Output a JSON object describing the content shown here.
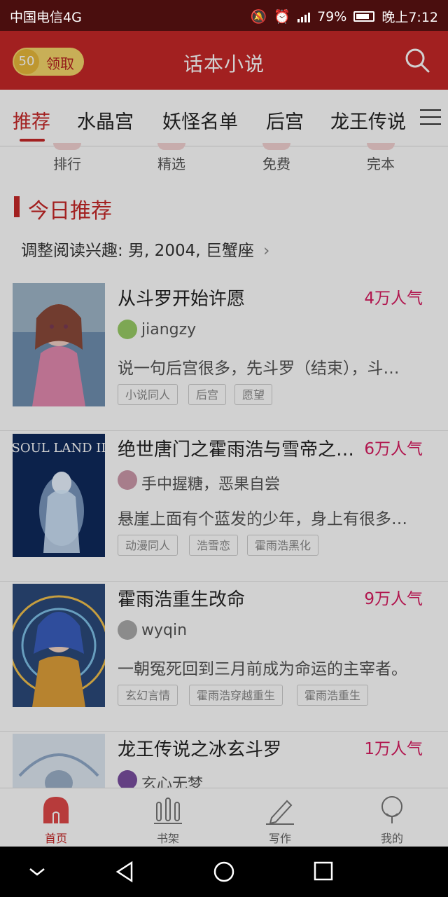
{
  "status": {
    "carrier": "中国电信4G",
    "battery": "79%",
    "time": "晚上7:12",
    "network": "4G"
  },
  "header": {
    "coin_value": "50",
    "coin_label": "领取",
    "title": "话本小说"
  },
  "tabs": [
    "推荐",
    "水晶宫",
    "妖怪名单",
    "后宫",
    "龙王传说"
  ],
  "quick": [
    "排行",
    "精选",
    "免费",
    "完本"
  ],
  "section": {
    "title": "今日推荐",
    "interest": "调整阅读兴趣: 男, 2004, 巨蟹座"
  },
  "books": [
    {
      "title": "从斗罗开始许愿",
      "popularity": "4万人气",
      "author": "jiangzy",
      "desc": "说一句后宫很多，先斗罗（结束），斗…",
      "tags": [
        "小说同人",
        "后宫",
        "愿望"
      ]
    },
    {
      "title": "绝世唐门之霍雨浩与雪帝之…",
      "popularity": "6万人气",
      "author": "手中握糖，恶果自尝",
      "desc": "悬崖上面有个蓝发的少年，身上有很多…",
      "tags": [
        "动漫同人",
        "浩雪恋",
        "霍雨浩黑化"
      ],
      "cover_text": "SOUL LAND II"
    },
    {
      "title": "霍雨浩重生改命",
      "popularity": "9万人气",
      "author": "wyqin",
      "desc": "一朝冤死回到三月前成为命运的主宰者。",
      "tags": [
        "玄幻言情",
        "霍雨浩穿越重生",
        "霍雨浩重生"
      ]
    },
    {
      "title": "龙王传说之冰玄斗罗",
      "popularity": "1万人气",
      "author": "玄心无梦",
      "desc": "",
      "tags": []
    }
  ],
  "bottomnav": [
    "首页",
    "书架",
    "写作",
    "我的"
  ],
  "colors": {
    "brand": "#c62828",
    "popularity": "#d81b60"
  }
}
